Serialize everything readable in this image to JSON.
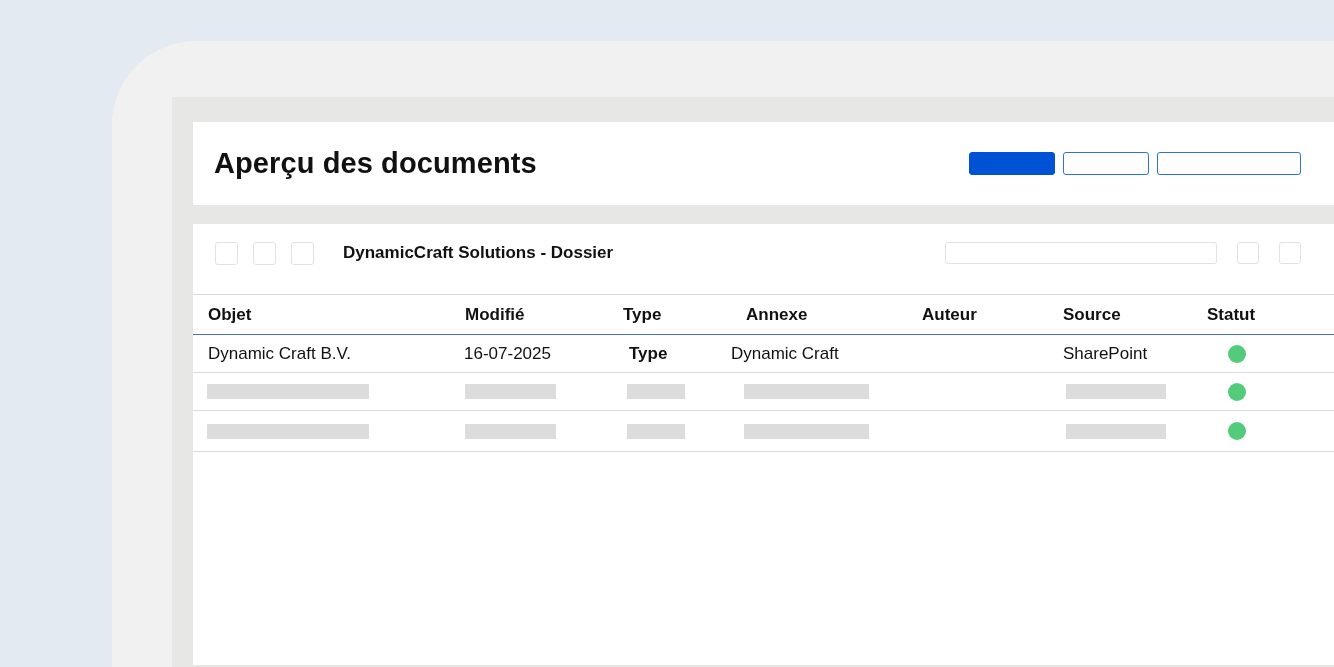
{
  "page": {
    "title": "Aperçu des documents",
    "actions": [
      {
        "kind": "primary"
      },
      {
        "kind": "outline"
      },
      {
        "kind": "outline"
      }
    ]
  },
  "panel": {
    "tools_left": [
      {
        "kind": "blank"
      },
      {
        "kind": "blank"
      },
      {
        "kind": "blank"
      }
    ],
    "title": "DynamicCraft Solutions - Dossier",
    "tools_right": [
      {
        "kind": "blank"
      },
      {
        "kind": "blank"
      }
    ]
  },
  "table": {
    "columns": [
      "Objet",
      "Modifié",
      "Type",
      "Annexe",
      "Auteur",
      "Source",
      "Statut"
    ],
    "rows": [
      {
        "cells": [
          {
            "kind": "text",
            "text": "Dynamic Craft B.V."
          },
          {
            "kind": "text",
            "text": "16-07-2025"
          },
          {
            "kind": "strong",
            "text": "Type"
          },
          {
            "kind": "text",
            "text": "Dynamic Craft"
          },
          {
            "kind": "empty"
          },
          {
            "kind": "text",
            "text": "SharePoint"
          }
        ],
        "color": "#52cc7a"
      },
      {
        "cells": [
          {
            "kind": "placeholder"
          },
          {
            "kind": "placeholder"
          },
          {
            "kind": "placeholder"
          },
          {
            "kind": "placeholder"
          },
          {
            "kind": "empty"
          },
          {
            "kind": "placeholder"
          }
        ],
        "color": "#52cc7a"
      },
      {
        "cells": [
          {
            "kind": "placeholder"
          },
          {
            "kind": "placeholder"
          },
          {
            "kind": "placeholder"
          },
          {
            "kind": "placeholder"
          },
          {
            "kind": "empty"
          },
          {
            "kind": "placeholder"
          }
        ],
        "color": "#52cc7a"
      }
    ]
  }
}
